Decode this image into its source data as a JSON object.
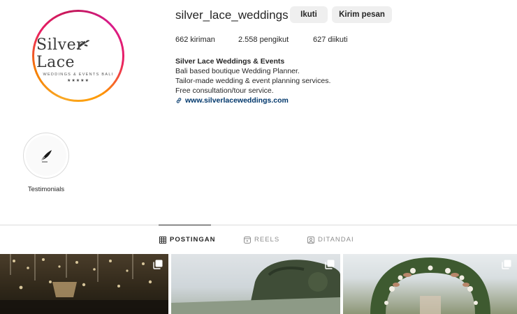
{
  "profile": {
    "username": "silver_lace_weddings",
    "logo": {
      "title": "Silver Lace",
      "subtitle": "WEDDINGS & EVENTS BALI",
      "stars": "★★★★★"
    }
  },
  "actions": {
    "follow_label": "Ikuti",
    "message_label": "Kirim pesan"
  },
  "stats": {
    "posts": "662 kiriman",
    "followers": "2.558 pengikut",
    "following": "627 diikuti"
  },
  "bio": {
    "name": "Silver Lace Weddings & Events",
    "lines": [
      "Bali based boutique Wedding Planner.",
      "Tailor-made wedding & event planning services.",
      "Free consultation/tour service."
    ],
    "link": "www.silverlaceweddings.com"
  },
  "highlights": [
    {
      "label": "Testimonials",
      "icon": "quill-icon"
    }
  ],
  "tabs": [
    {
      "label": "POSTINGAN",
      "icon": "grid-icon",
      "active": true
    },
    {
      "label": "REELS",
      "icon": "reels-icon",
      "active": false
    },
    {
      "label": "DITANDAI",
      "icon": "tagged-icon",
      "active": false
    }
  ],
  "grid": [
    {
      "icon": "multiple-posts-icon"
    },
    {
      "icon": "multiple-posts-icon"
    },
    {
      "icon": "multiple-posts-icon"
    }
  ],
  "colors": {
    "link": "#00376b",
    "button_bg": "#efefef",
    "divider": "#dbdbdb",
    "story_ring": [
      "#f9a825",
      "#e91e63",
      "#d81b8a"
    ]
  }
}
